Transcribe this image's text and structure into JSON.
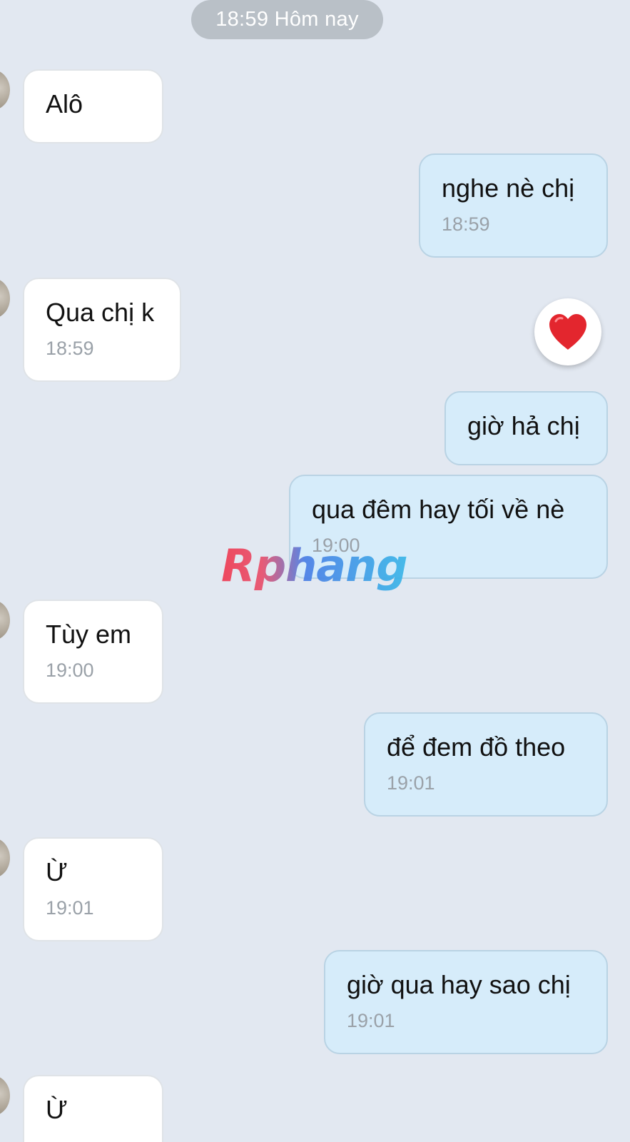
{
  "date_separator": "18:59 Hôm nay",
  "reaction": {
    "icon": "heart-icon",
    "color": "#e3262e"
  },
  "watermark": "Rphang",
  "messages": [
    {
      "side": "in",
      "text": "Alô",
      "time": ""
    },
    {
      "side": "out",
      "text": "nghe nè chị",
      "time": "18:59"
    },
    {
      "side": "in",
      "text": "Qua chị k",
      "time": "18:59"
    },
    {
      "side": "out",
      "text": "giờ hả chị",
      "time": ""
    },
    {
      "side": "out",
      "text": "qua đêm hay tối về nè",
      "time": "19:00"
    },
    {
      "side": "in",
      "text": "Tùy em",
      "time": "19:00"
    },
    {
      "side": "out",
      "text": "để đem đồ theo",
      "time": "19:01"
    },
    {
      "side": "in",
      "text": "Ừ",
      "time": "19:01"
    },
    {
      "side": "out",
      "text": "giờ qua hay sao chị",
      "time": "19:01"
    },
    {
      "side": "in",
      "text": "Ừ",
      "time": ""
    }
  ],
  "colors": {
    "background": "#e2e8f1",
    "incoming_bubble": "#ffffff",
    "outgoing_bubble": "#d6ecfa",
    "timestamp": "#9aa1a8"
  }
}
